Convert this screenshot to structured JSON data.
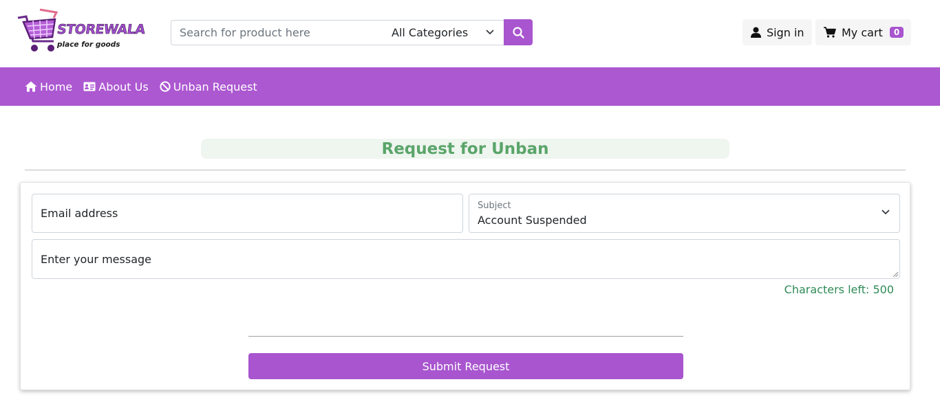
{
  "brand": {
    "name": "STOREWALA",
    "tagline": "place for goods",
    "accent": "#ac58d1"
  },
  "header": {
    "search_placeholder": "Search for product here",
    "category_selected": "All Categories",
    "search_icon": "magnifier-icon",
    "signin_label": "Sign in",
    "cart_label": "My cart",
    "cart_count": "0"
  },
  "nav": {
    "items": [
      {
        "label": "Home",
        "icon": "home-icon"
      },
      {
        "label": "About Us",
        "icon": "id-card-icon"
      },
      {
        "label": "Unban Request",
        "icon": "ban-icon"
      }
    ]
  },
  "page": {
    "title": "Request for Unban"
  },
  "form": {
    "email_label": "Email address",
    "subject_label": "Subject",
    "subject_value": "Account Suspended",
    "message_label": "Enter your message",
    "chars_left": "Characters left: 500",
    "submit_label": "Submit Request"
  }
}
